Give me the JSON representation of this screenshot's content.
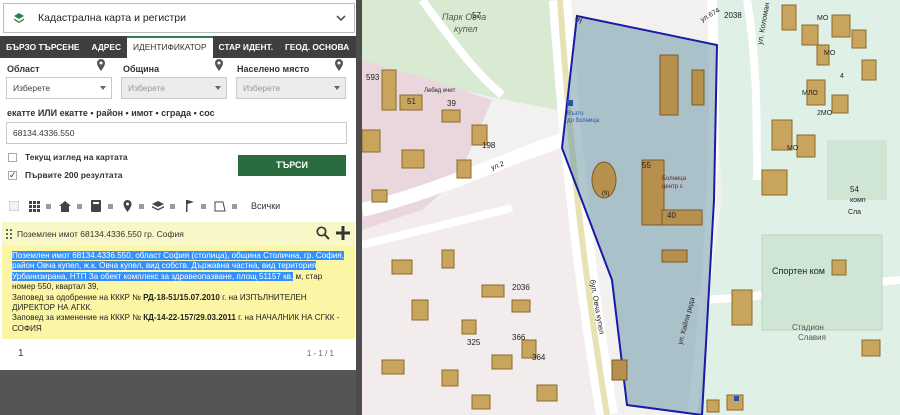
{
  "layer_selector": {
    "label": "Кадастрална карта и регистри"
  },
  "tabs": [
    {
      "label": "БЪРЗО ТЪРСЕНЕ"
    },
    {
      "label": "АДРЕС"
    },
    {
      "label": "ИДЕНТИФИКАТОР",
      "active": true
    },
    {
      "label": "СТАР ИДЕНТ."
    },
    {
      "label": "ГЕОД. ОСНОВА"
    }
  ],
  "form": {
    "region_label": "Област",
    "region_value": "Изберете",
    "municipality_label": "Община",
    "municipality_value": "Изберете",
    "settlement_label": "Населено място",
    "settlement_value": "Изберете",
    "identifier_label": "екатте ИЛИ екатте • район • имот • сграда • сос",
    "identifier_value": "68134.4336.550",
    "current_view_label": "Текущ изглед на картата",
    "first200_label": "Първите 200 резултата",
    "first200_checked_mark": "✓",
    "search_button": "ТЪРСИ",
    "all_label": "Всички"
  },
  "result": {
    "header": "Поземлен имот 68134.4336.550 гр. София",
    "desc_highlight": "Поземлен имот 68134.4336.550, област София (столица), община Столична, гр. София, район Овча купел, ж.к. Овча купел, вид собств. Държавна частна, вид територия Урбанизирана, НТП За обект комплекс за здравеопазване, площ 51157 кв.",
    "desc_rest": " м, стар номер 550, квартал 39,",
    "approval_prefix": "Заповед за одобрение на КККР № ",
    "approval_code": "РД-18-51/15.07.2010",
    "approval_suffix": " г. на ИЗПЪЛНИТЕЛЕН ДИРЕКТОР НА АГКК.",
    "change_prefix": "Заповед за изменение на КККР № ",
    "change_code": "КД-14-22-157/29.03.2011",
    "change_suffix": " г. на НАЧАЛНИК НА СГКК - СОФИЯ"
  },
  "pager": {
    "page": "1",
    "info": "1 - 1 / 1"
  },
  "map": {
    "labels": {
      "park": "Парк Овча",
      "park2": "купел",
      "n57": "57",
      "n2038": "2038",
      "street_bul": "бу",
      "street_ul674": "ул.674",
      "street_koloman": "ул. Коломан",
      "n593": "593",
      "lebed": "Лебед ечит",
      "n51": "51",
      "n39": "39",
      "n198": "198",
      "n55": "55",
      "vazdo": "Възто",
      "vazdo2": "до болница",
      "hospital1": "Болница",
      "hospital2": "центр с",
      "n40": "40",
      "street_ul2": "ул.2",
      "bul_ovcha_kupel": "бул. Овча купел",
      "chemist": "(9)",
      "n2036": "2036",
      "n366": "366",
      "n364": "364",
      "n325": "325",
      "kak_rayl": "ул. Кайла реда",
      "sports": "Спортен ком",
      "stadium": "Стадион",
      "stadium2": "Славия",
      "n54": "54",
      "komp": "комп",
      "sla": "Сла",
      "mo": "МО",
      "n4": "4",
      "mlo": "МЛО",
      "mo2": "2МО"
    }
  }
}
